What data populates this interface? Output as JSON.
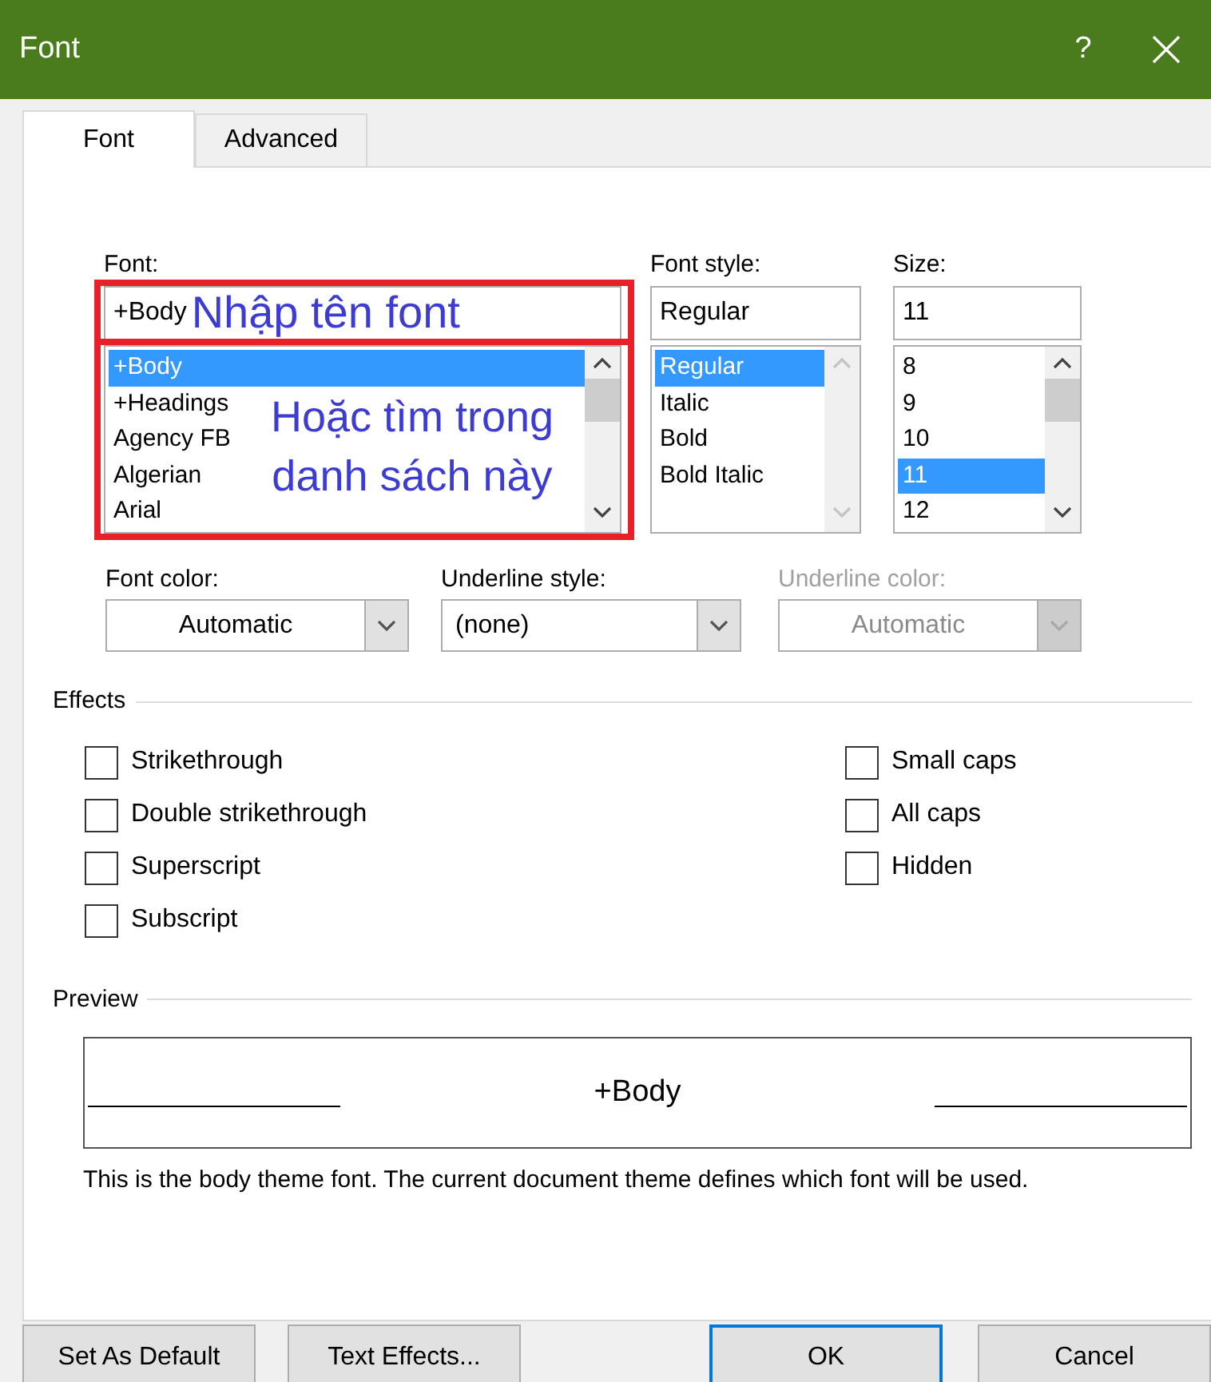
{
  "window": {
    "title": "Font",
    "help": "?"
  },
  "tabs": [
    {
      "label": "Font",
      "selected": true
    },
    {
      "label": "Advanced",
      "selected": false
    }
  ],
  "font": {
    "label": "Font:",
    "value": "+Body",
    "scrollable": true,
    "items": [
      {
        "label": "+Body",
        "selected": true
      },
      {
        "label": "+Headings",
        "selected": false
      },
      {
        "label": "Agency FB",
        "selected": false
      },
      {
        "label": "Algerian",
        "selected": false
      },
      {
        "label": "Arial",
        "selected": false
      }
    ],
    "field_note": "Nhập tên font",
    "list_note": "Hoặc tìm trong danh sách này"
  },
  "font_style": {
    "label": "Font style:",
    "value": "Regular",
    "scrollable": false,
    "items": [
      {
        "label": "Regular",
        "selected": true
      },
      {
        "label": "Italic",
        "selected": false
      },
      {
        "label": "Bold",
        "selected": false
      },
      {
        "label": "Bold Italic",
        "selected": false
      }
    ]
  },
  "size": {
    "label": "Size:",
    "value": "11",
    "scrollable": true,
    "items": [
      {
        "label": "8",
        "selected": false
      },
      {
        "label": "9",
        "selected": false
      },
      {
        "label": "10",
        "selected": false
      },
      {
        "label": "11",
        "selected": true
      },
      {
        "label": "12",
        "selected": false
      }
    ]
  },
  "dropdowns": [
    {
      "kind": "color",
      "label": "Font color:",
      "value": "Automatic",
      "disabled": false
    },
    {
      "kind": "style",
      "label": "Underline style:",
      "value": "(none)",
      "disabled": false
    },
    {
      "kind": "color",
      "label": "Underline color:",
      "value": "Automatic",
      "disabled": true
    }
  ],
  "effects": {
    "label": "Effects",
    "left": [
      {
        "label": "Strikethrough",
        "checked": false
      },
      {
        "label": "Double strikethrough",
        "checked": false
      },
      {
        "label": "Superscript",
        "checked": false
      },
      {
        "label": "Subscript",
        "checked": false
      }
    ],
    "right": [
      {
        "label": "Small caps",
        "checked": false
      },
      {
        "label": "All caps",
        "checked": false
      },
      {
        "label": "Hidden",
        "checked": false
      }
    ]
  },
  "preview": {
    "label": "Preview",
    "sample": "+Body",
    "description": "This is the body theme font. The current document theme defines which font will be used."
  },
  "buttons": [
    {
      "label": "Set As Default",
      "default": false
    },
    {
      "label": "Text Effects...",
      "default": false
    },
    {
      "label": "OK",
      "default": true
    },
    {
      "label": "Cancel",
      "default": false
    }
  ]
}
